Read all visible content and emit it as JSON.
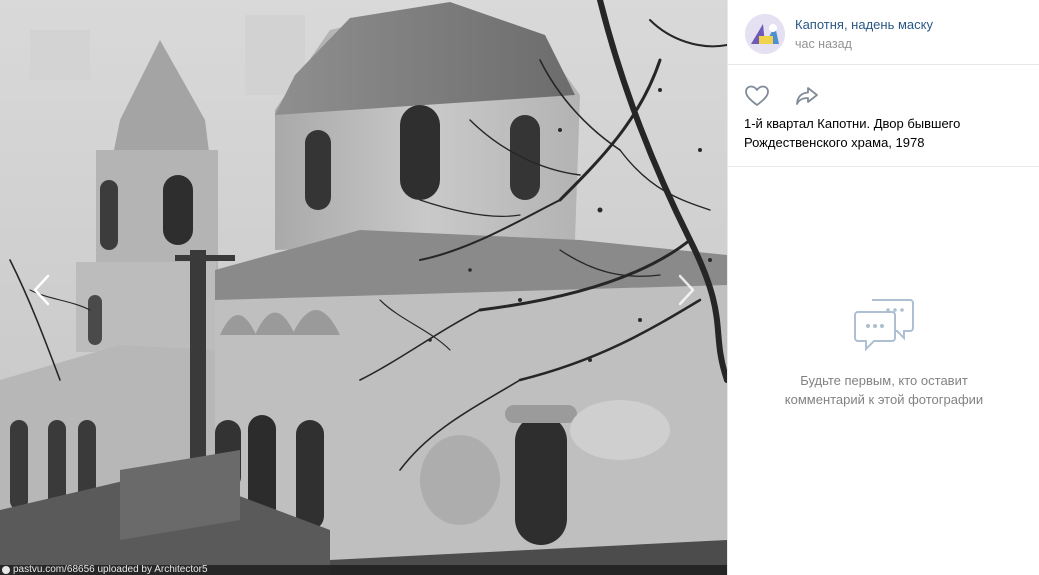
{
  "photo": {
    "watermark": "pastvu.com/68656  uploaded by Architector5"
  },
  "post": {
    "author": "Капотня, надень маску",
    "time": "час назад",
    "caption": "1-й квартал Капотни. Двор бывшего Рождественского храма, 1978"
  },
  "comments": {
    "empty_text": "Будьте первым, кто оставит комментарий к этой фотографии"
  },
  "icons": {
    "prev": "chevron-left-icon",
    "next": "chevron-right-icon",
    "like": "heart-icon",
    "share": "share-arrow-icon",
    "comments": "speech-bubbles-icon"
  },
  "colors": {
    "link": "#2a5885",
    "muted": "#939393",
    "icon": "#818c99",
    "empty_icon": "#aebfd1"
  }
}
